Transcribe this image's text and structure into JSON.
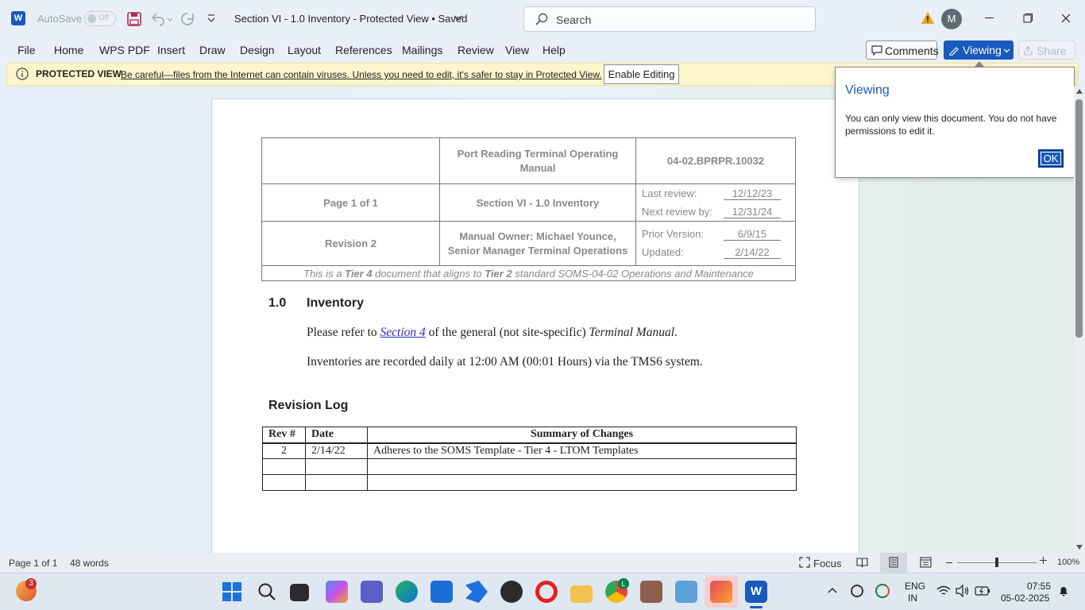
{
  "titlebar": {
    "autosave": "AutoSave",
    "autosave_state": "Off",
    "doc_title": "Section VI - 1.0 Inventory  -  Protected View  •  Saved",
    "search_placeholder": "Search",
    "avatar_initial": "M"
  },
  "menu": [
    "File",
    "Home",
    "WPS PDF",
    "Insert",
    "Draw",
    "Design",
    "Layout",
    "References",
    "Mailings",
    "Review",
    "View",
    "Help"
  ],
  "ribbon_right": {
    "comments": "Comments",
    "viewing": "Viewing",
    "share": "Share"
  },
  "protected_bar": {
    "label": "PROTECTED VIEW",
    "message": "Be careful—files from the Internet can contain viruses. Unless you need to edit, it's safer to stay in Protected View.",
    "button": "Enable Editing"
  },
  "popup": {
    "title": "Viewing",
    "text": "You can only view this document. You do not have permissions to edit it.",
    "ok": "OK"
  },
  "doc": {
    "header": {
      "manual_title": "Port Reading Terminal Operating Manual",
      "doc_number": "04-02.BPRPR.10032",
      "page": "Page 1 of 1",
      "section": "Section VI - 1.0 Inventory",
      "revision": "Revision 2",
      "owner": "Manual Owner: Michael Younce, Senior Manager Terminal Operations",
      "last_review_label": "Last review:",
      "last_review": "12/12/23",
      "next_review_label": "Next review by:",
      "next_review": "12/31/24",
      "prior_version_label": "Prior Version:",
      "prior_version": "6/9/15",
      "updated_label": "Updated:",
      "updated": "2/14/22",
      "tier_note": {
        "p1": "This is a ",
        "b1": "Tier 4",
        "p2": " document that aligns to ",
        "b2": "Tier 2",
        "p3": " standard SOMS-04-02 Operations and Maintenance"
      }
    },
    "heading_num": "1.0",
    "heading": "Inventory",
    "para1": {
      "pre": "Please refer to ",
      "link": "Section 4",
      "mid": " of the general (not site-specific) ",
      "italic": "Terminal Manual",
      "post": "."
    },
    "para2": "Inventories are recorded daily at 12:00 AM (00:01 Hours) via the TMS6 system.",
    "revlog_heading": "Revision Log",
    "revlog": {
      "headers": [
        "Rev #",
        "Date",
        "Summary of Changes"
      ],
      "rows": [
        [
          "2",
          "2/14/22",
          "Adheres to the SOMS Template - Tier 4 - LTOM Templates"
        ],
        [
          "",
          "",
          ""
        ],
        [
          "",
          "",
          ""
        ]
      ]
    }
  },
  "status": {
    "page": "Page 1 of 1",
    "words": "48 words",
    "focus": "Focus",
    "zoom": "100%"
  },
  "taskbar": {
    "notif_count": "3",
    "lang1": "ENG",
    "lang2": "IN",
    "time": "07:55",
    "date": "05-02-2025"
  },
  "colors": {
    "accent": "#185abd",
    "warning": "#e8a317",
    "protected_bg": "#fdf5cc"
  }
}
